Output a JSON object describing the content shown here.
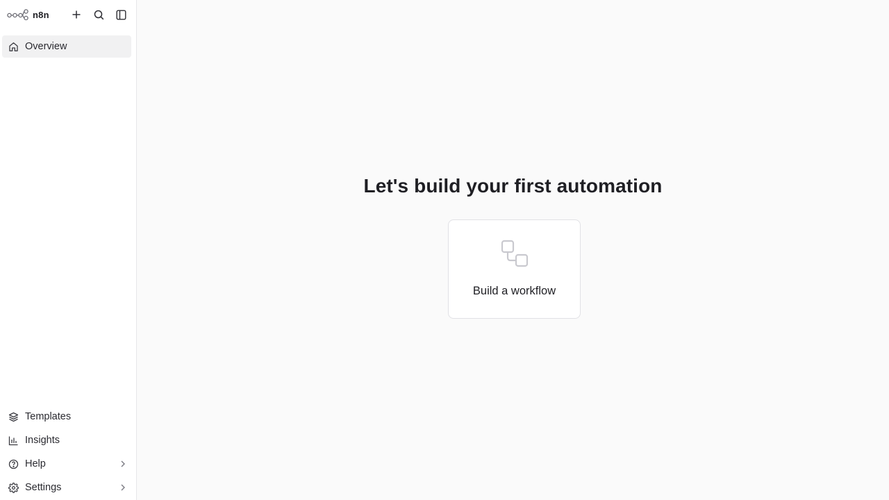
{
  "app": {
    "name": "n8n"
  },
  "sidebar": {
    "top_items": [
      {
        "label": "Overview",
        "icon": "home-icon",
        "active": true
      }
    ],
    "bottom_items": [
      {
        "label": "Templates",
        "icon": "layers-icon"
      },
      {
        "label": "Insights",
        "icon": "bar-chart-icon"
      },
      {
        "label": "Help",
        "icon": "help-circle-icon",
        "has_submenu": true
      },
      {
        "label": "Settings",
        "icon": "gear-icon",
        "has_submenu": true
      }
    ]
  },
  "main": {
    "title": "Let's build your first automation",
    "card": {
      "label": "Build a workflow",
      "icon": "workflow-nodes-icon"
    }
  },
  "colors": {
    "background": "#fafafa",
    "sidebar_bg": "#ffffff",
    "active_item": "#f1f1f2",
    "text": "#1f1f24",
    "border": "#e1e1e5"
  }
}
